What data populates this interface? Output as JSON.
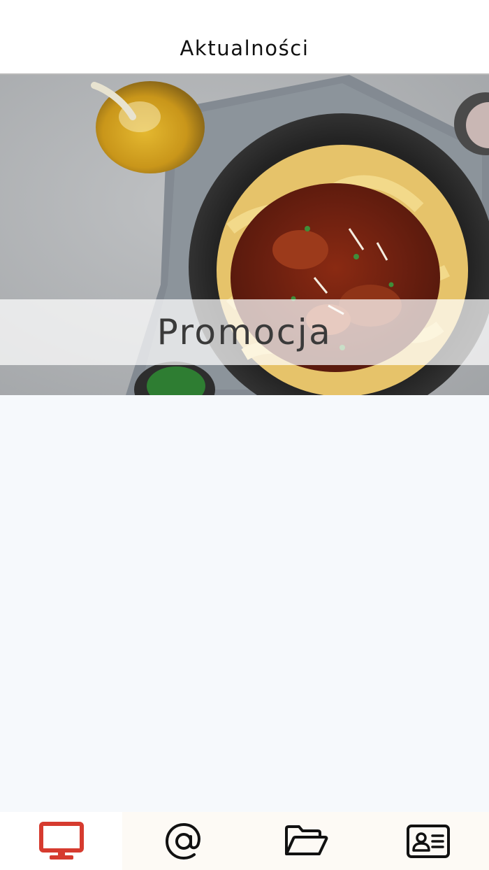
{
  "header": {
    "title": "Aktualności"
  },
  "promo": {
    "label": "Promocja",
    "image_description": "pappardelle-bolognese-dish-photo"
  },
  "tabbar": {
    "active_color": "#d63b2f",
    "inactive_color": "#111111",
    "tabs": [
      {
        "icon": "monitor-icon",
        "active": true
      },
      {
        "icon": "at-sign-icon",
        "active": false
      },
      {
        "icon": "folder-open-icon",
        "active": false
      },
      {
        "icon": "contact-card-icon",
        "active": false
      }
    ]
  }
}
